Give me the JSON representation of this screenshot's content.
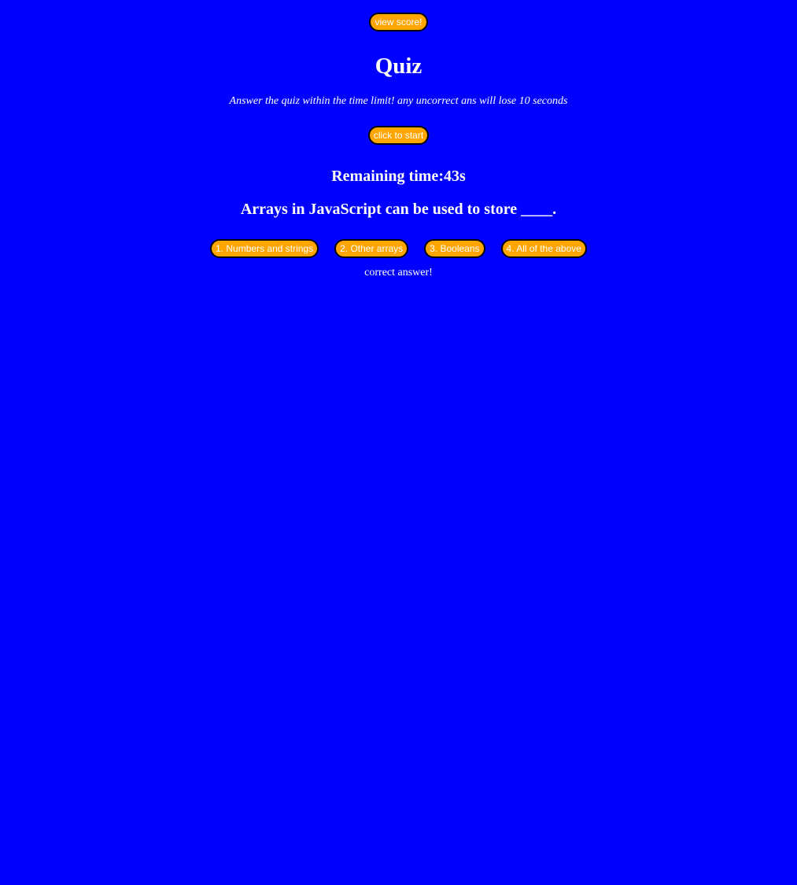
{
  "header": {
    "view_score_label": "view score!"
  },
  "quiz": {
    "title": "Quiz",
    "instructions": "Answer the quiz within the time limit! any uncorrect ans will lose 10 seconds",
    "start_label": "click to start",
    "timer_text": "Remaining time:43s",
    "question": "Arrays in JavaScript can be used to store ____.",
    "choices": [
      {
        "label": "1. Numbers and strings"
      },
      {
        "label": "2. Other arrays"
      },
      {
        "label": "3. Booleans"
      },
      {
        "label": "4. All of the above"
      }
    ],
    "feedback": "correct answer!"
  },
  "colors": {
    "background": "#0000ff",
    "button": "#ffa500",
    "button_border": "#000000",
    "text": "#ffffff"
  }
}
